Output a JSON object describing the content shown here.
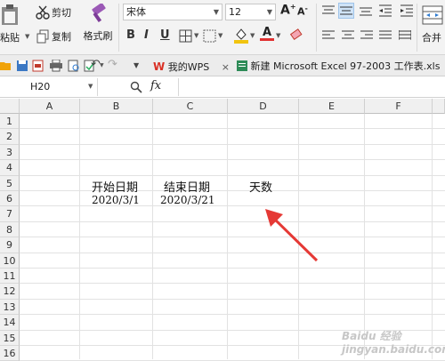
{
  "ribbon": {
    "paste_label": "粘贴",
    "cut_label": "剪切",
    "copy_label": "复制",
    "format_painter_label": "格式刷",
    "font_name": "宋体",
    "font_size": "12",
    "merge_label": "合并"
  },
  "quickbar": {
    "wps_tab_label": "我的WPS",
    "doc_tab_label": "新建 Microsoft Excel 97-2003 工作表.xls",
    "accent_color": "#d93025"
  },
  "formula_bar": {
    "name_box": "H20",
    "fx_label": "fx",
    "value": ""
  },
  "sheet": {
    "columns": [
      "A",
      "B",
      "C",
      "D",
      "E",
      "F"
    ],
    "rows": [
      "1",
      "2",
      "3",
      "4",
      "5",
      "6",
      "7",
      "8",
      "9",
      "10",
      "11",
      "12",
      "13",
      "14",
      "15",
      "16"
    ],
    "cells": {
      "B5": "开始日期",
      "C5": "结束日期",
      "D5": "天数",
      "B6": "2020/3/1",
      "C6": "2020/3/21"
    }
  },
  "annotation": {
    "arrow_color": "#e53935"
  },
  "watermark": "Baidu 经验 jingyan.baidu.com"
}
